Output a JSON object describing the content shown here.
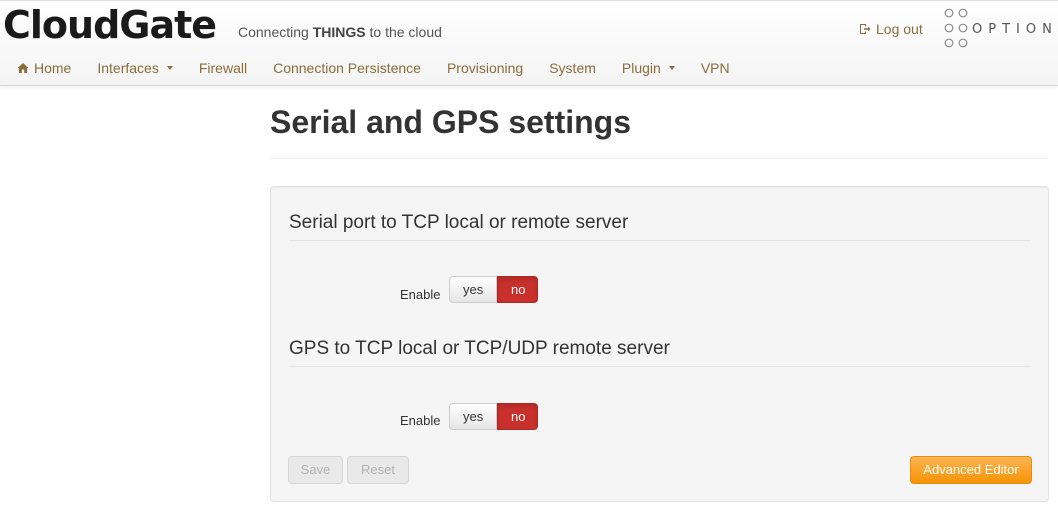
{
  "header": {
    "brand": "CloudGate",
    "tagline_prefix": "Connecting ",
    "tagline_bold": "THINGS",
    "tagline_suffix": " to the cloud",
    "logout_label": "Log out",
    "partner_logo_text": "OPTION"
  },
  "nav": {
    "items": [
      {
        "label": "Home",
        "icon": "home-icon"
      },
      {
        "label": "Interfaces",
        "dropdown": true
      },
      {
        "label": "Firewall"
      },
      {
        "label": "Connection Persistence"
      },
      {
        "label": "Provisioning"
      },
      {
        "label": "System"
      },
      {
        "label": "Plugin",
        "dropdown": true
      },
      {
        "label": "VPN"
      }
    ]
  },
  "page": {
    "title": "Serial and GPS settings"
  },
  "sections": [
    {
      "title": "Serial port to TCP local or remote server",
      "field_label": "Enable",
      "toggle": {
        "yes": "yes",
        "no": "no",
        "selected": "no"
      }
    },
    {
      "title": "GPS to TCP local or TCP/UDP remote server",
      "field_label": "Enable",
      "toggle": {
        "yes": "yes",
        "no": "no",
        "selected": "no"
      }
    }
  ],
  "actions": {
    "save_label": "Save",
    "reset_label": "Reset",
    "advanced_label": "Advanced Editor"
  },
  "colors": {
    "accent_nav": "#8a6d3b",
    "toggle_active": "#c9302c",
    "warning_button": "#f89406"
  }
}
